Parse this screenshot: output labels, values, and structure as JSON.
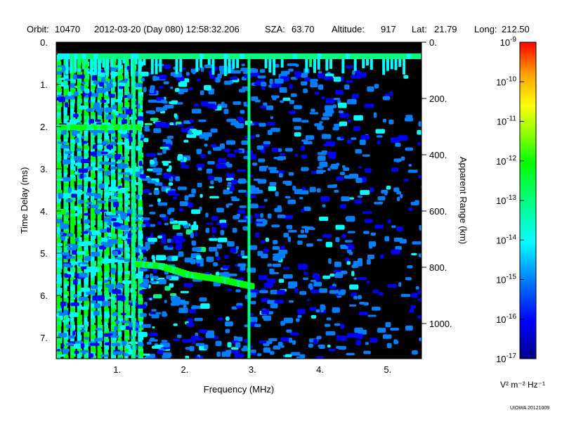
{
  "header": {
    "orbit_label": "Orbit:",
    "orbit_value": "10470",
    "datetime": "2012-03-20 (Day 080) 12:58:32.206",
    "sza_label": "SZA:",
    "sza_value": "63.70",
    "altitude_label": "Altitude:",
    "altitude_value": "917",
    "lat_label": "Lat:",
    "lat_value": "21.79",
    "long_label": "Long:",
    "long_value": "212.50"
  },
  "footer": {
    "credit": "UIOWA 20121009"
  },
  "chart_data": {
    "type": "heatmap",
    "xlabel": "Frequency (MHz)",
    "ylabel": "Time Delay (ms)",
    "ylabel_right": "Apparent Range (km)",
    "x_ticks": [
      "1.",
      "2.",
      "3.",
      "4.",
      "5."
    ],
    "x_tick_values": [
      1,
      2,
      3,
      4,
      5
    ],
    "xlim": [
      0.1,
      5.5
    ],
    "y_ticks": [
      "0.",
      "1.",
      "2.",
      "3.",
      "4.",
      "5.",
      "6.",
      "7."
    ],
    "y_tick_values": [
      0,
      1,
      2,
      3,
      4,
      5,
      6,
      7
    ],
    "ylim": [
      0,
      7.5
    ],
    "y2_ticks": [
      "0.",
      "200.",
      "400.",
      "600.",
      "800.",
      "1000."
    ],
    "y2_tick_values": [
      0,
      200,
      400,
      600,
      800,
      1000
    ],
    "y2lim": [
      0,
      1125
    ],
    "colorbar": {
      "scale": "log",
      "range_exponents": [
        -17,
        -9
      ],
      "tick_base": "10",
      "tick_exponents": [
        "-9",
        "-10",
        "-11",
        "-12",
        "-13",
        "-14",
        "-15",
        "-16",
        "-17"
      ],
      "units_label": "V² m⁻² Hz⁻¹",
      "colors": [
        "#00008b",
        "#0000ff",
        "#0080ff",
        "#00ffff",
        "#00ff80",
        "#00ff00",
        "#80ff00",
        "#ffff00",
        "#ffa000",
        "#ff0000"
      ]
    },
    "features": {
      "surface_echo_delay_ms": 0.3,
      "ionospheric_trace": [
        {
          "f": 1.25,
          "t": 5.25
        },
        {
          "f": 1.6,
          "t": 5.3
        },
        {
          "f": 2.0,
          "t": 5.5
        },
        {
          "f": 2.5,
          "t": 5.62
        },
        {
          "f": 2.95,
          "t": 5.78
        }
      ],
      "cutoff_boundary_f": [
        1.25,
        2.95
      ]
    }
  }
}
